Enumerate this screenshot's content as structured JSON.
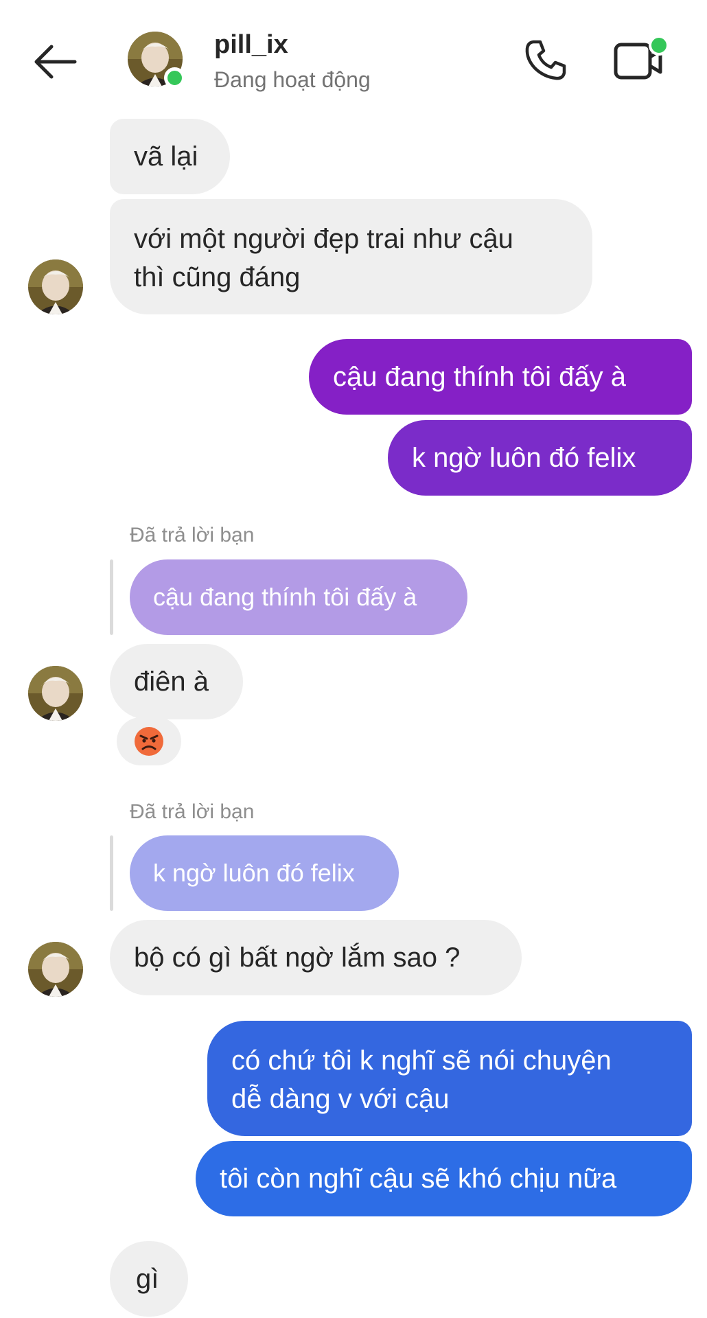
{
  "header": {
    "username": "pill_ix",
    "status": "Đang hoạt động",
    "accent_online": "#35c759",
    "icons": [
      "back-arrow-icon",
      "phone-icon",
      "video-camera-icon"
    ]
  },
  "messages": {
    "m1": "vã lại",
    "m2_line1": "với một người đẹp trai như cậu",
    "m2_line2": "thì cũng đáng",
    "m3": "cậu đang thính tôi đấy à",
    "m4": "k ngờ luôn đó felix",
    "reply1_label": "Đã trả lời bạn",
    "reply1_quote": "cậu đang thính tôi đấy à",
    "m5": "điên à",
    "m6_emoji": "😡",
    "reply2_label": "Đã trả lời bạn",
    "reply2_quote": "k ngờ luôn đó felix",
    "m7": "bộ có gì bất ngờ lắm sao ?",
    "m8_line1": "có chứ tôi k nghĩ sẽ nói chuyện",
    "m8_line2": "dễ dàng v với cậu",
    "m9": "tôi còn nghĩ cậu sẽ khó chịu nữa",
    "m10": "gì"
  },
  "colors": {
    "incoming_bg": "#efefef",
    "outgoing_purple": "#8520c6",
    "outgoing_violet": "#7b2cc9",
    "outgoing_blue1": "#3467e0",
    "outgoing_blue2": "#2d6de6",
    "quote1": "#b39be6",
    "quote2": "#a3a8ee"
  }
}
